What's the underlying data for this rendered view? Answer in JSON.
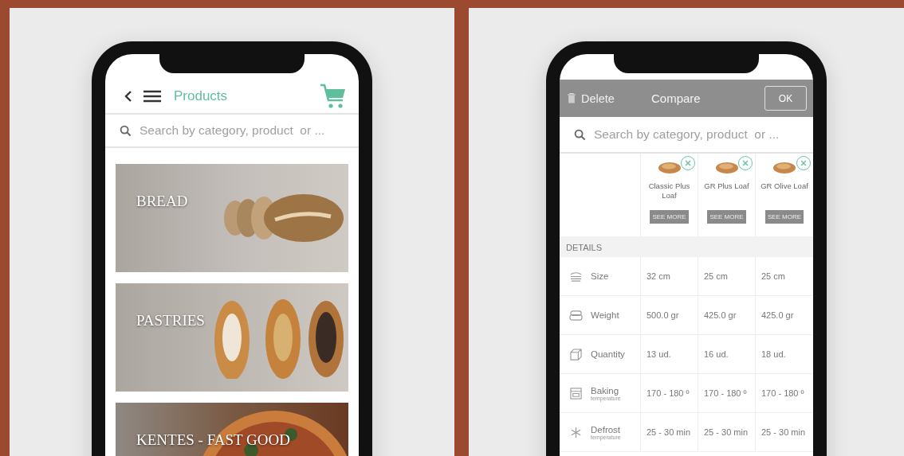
{
  "products_screen": {
    "header": {
      "title": "Products"
    },
    "search": {
      "placeholder": "Search by category, product  or ..."
    },
    "categories": [
      {
        "label": "BREAD",
        "kind": "bread"
      },
      {
        "label": "PASTRIES",
        "kind": "pastries"
      },
      {
        "label": "KENTES - FAST GOOD",
        "kind": "pizza"
      }
    ]
  },
  "compare_screen": {
    "toolbar": {
      "delete": "Delete",
      "title": "Compare",
      "ok": "OK"
    },
    "search": {
      "placeholder": "Search by category, product  or ..."
    },
    "products": [
      {
        "name": "Classic Plus Loaf",
        "button": "SEE MORE"
      },
      {
        "name": "GR Plus Loaf",
        "button": "SEE MORE"
      },
      {
        "name": "GR Olive Loaf",
        "button": "SEE MORE"
      }
    ],
    "section": "DETAILS",
    "rows": [
      {
        "kind": "size",
        "label": "Size",
        "values": [
          "32 cm",
          "25 cm",
          "25 cm"
        ]
      },
      {
        "kind": "weight",
        "label": "Weight",
        "values": [
          "500.0 gr",
          "425.0 gr",
          "425.0 gr"
        ]
      },
      {
        "kind": "quantity",
        "label": "Quantity",
        "values": [
          "13 ud.",
          "16 ud.",
          "18 ud."
        ]
      },
      {
        "kind": "baking",
        "label": "Baking",
        "sublabel": "temperature",
        "values": [
          "170 - 180 º",
          "170 - 180 º",
          "170 - 180 º"
        ]
      },
      {
        "kind": "defrost",
        "label": "Defrost",
        "sublabel": "temperature",
        "values": [
          "25 - 30 min",
          "25 - 30 min",
          "25 - 30 min"
        ]
      }
    ]
  }
}
